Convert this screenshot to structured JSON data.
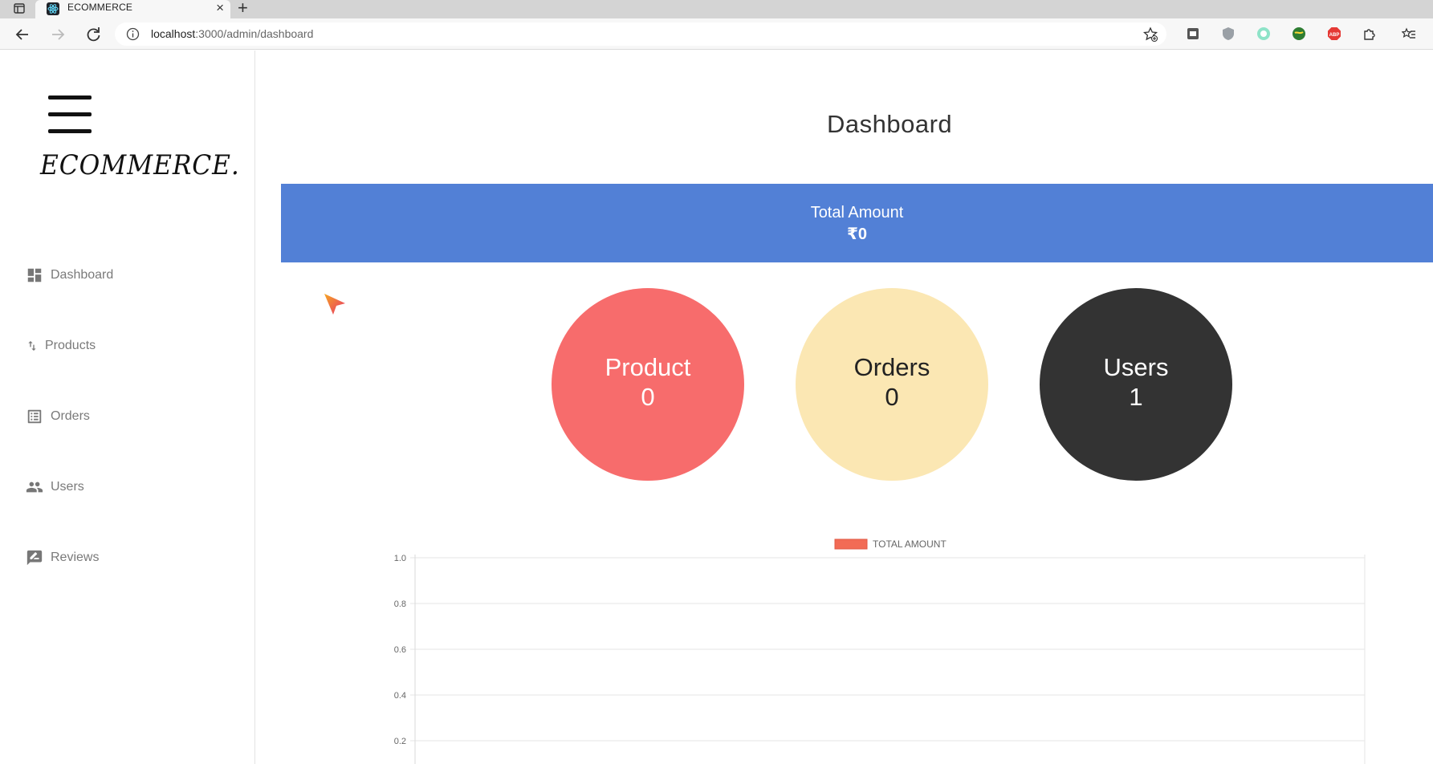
{
  "browser": {
    "tab_title": "ECOMMERCE",
    "url_host": "localhost",
    "url_rest": ":3000/admin/dashboard"
  },
  "sidebar": {
    "brand": "ECOMMERCE.",
    "items": [
      {
        "label": "Dashboard",
        "icon": "dashboard-icon"
      },
      {
        "label": "Products",
        "icon": "import-export-icon"
      },
      {
        "label": "Orders",
        "icon": "list-alt-icon"
      },
      {
        "label": "Users",
        "icon": "people-icon"
      },
      {
        "label": "Reviews",
        "icon": "rate-review-icon"
      }
    ]
  },
  "main": {
    "title": "Dashboard",
    "total": {
      "label": "Total Amount",
      "value": "₹0"
    },
    "summary": [
      {
        "label": "Product",
        "value": "0",
        "color": "#f76c6c"
      },
      {
        "label": "Orders",
        "value": "0",
        "color": "#fbe7b3"
      },
      {
        "label": "Users",
        "value": "1",
        "color": "#333333"
      }
    ]
  },
  "chart_data": {
    "type": "line",
    "legend": [
      "TOTAL AMOUNT"
    ],
    "legend_color": "#f26b55",
    "series": [
      {
        "name": "TOTAL AMOUNT",
        "values": []
      }
    ],
    "y_ticks": [
      "1.0",
      "0.8",
      "0.6",
      "0.4",
      "0.2"
    ],
    "ylim": [
      0,
      1
    ],
    "grid": true,
    "legend_position": "top"
  }
}
